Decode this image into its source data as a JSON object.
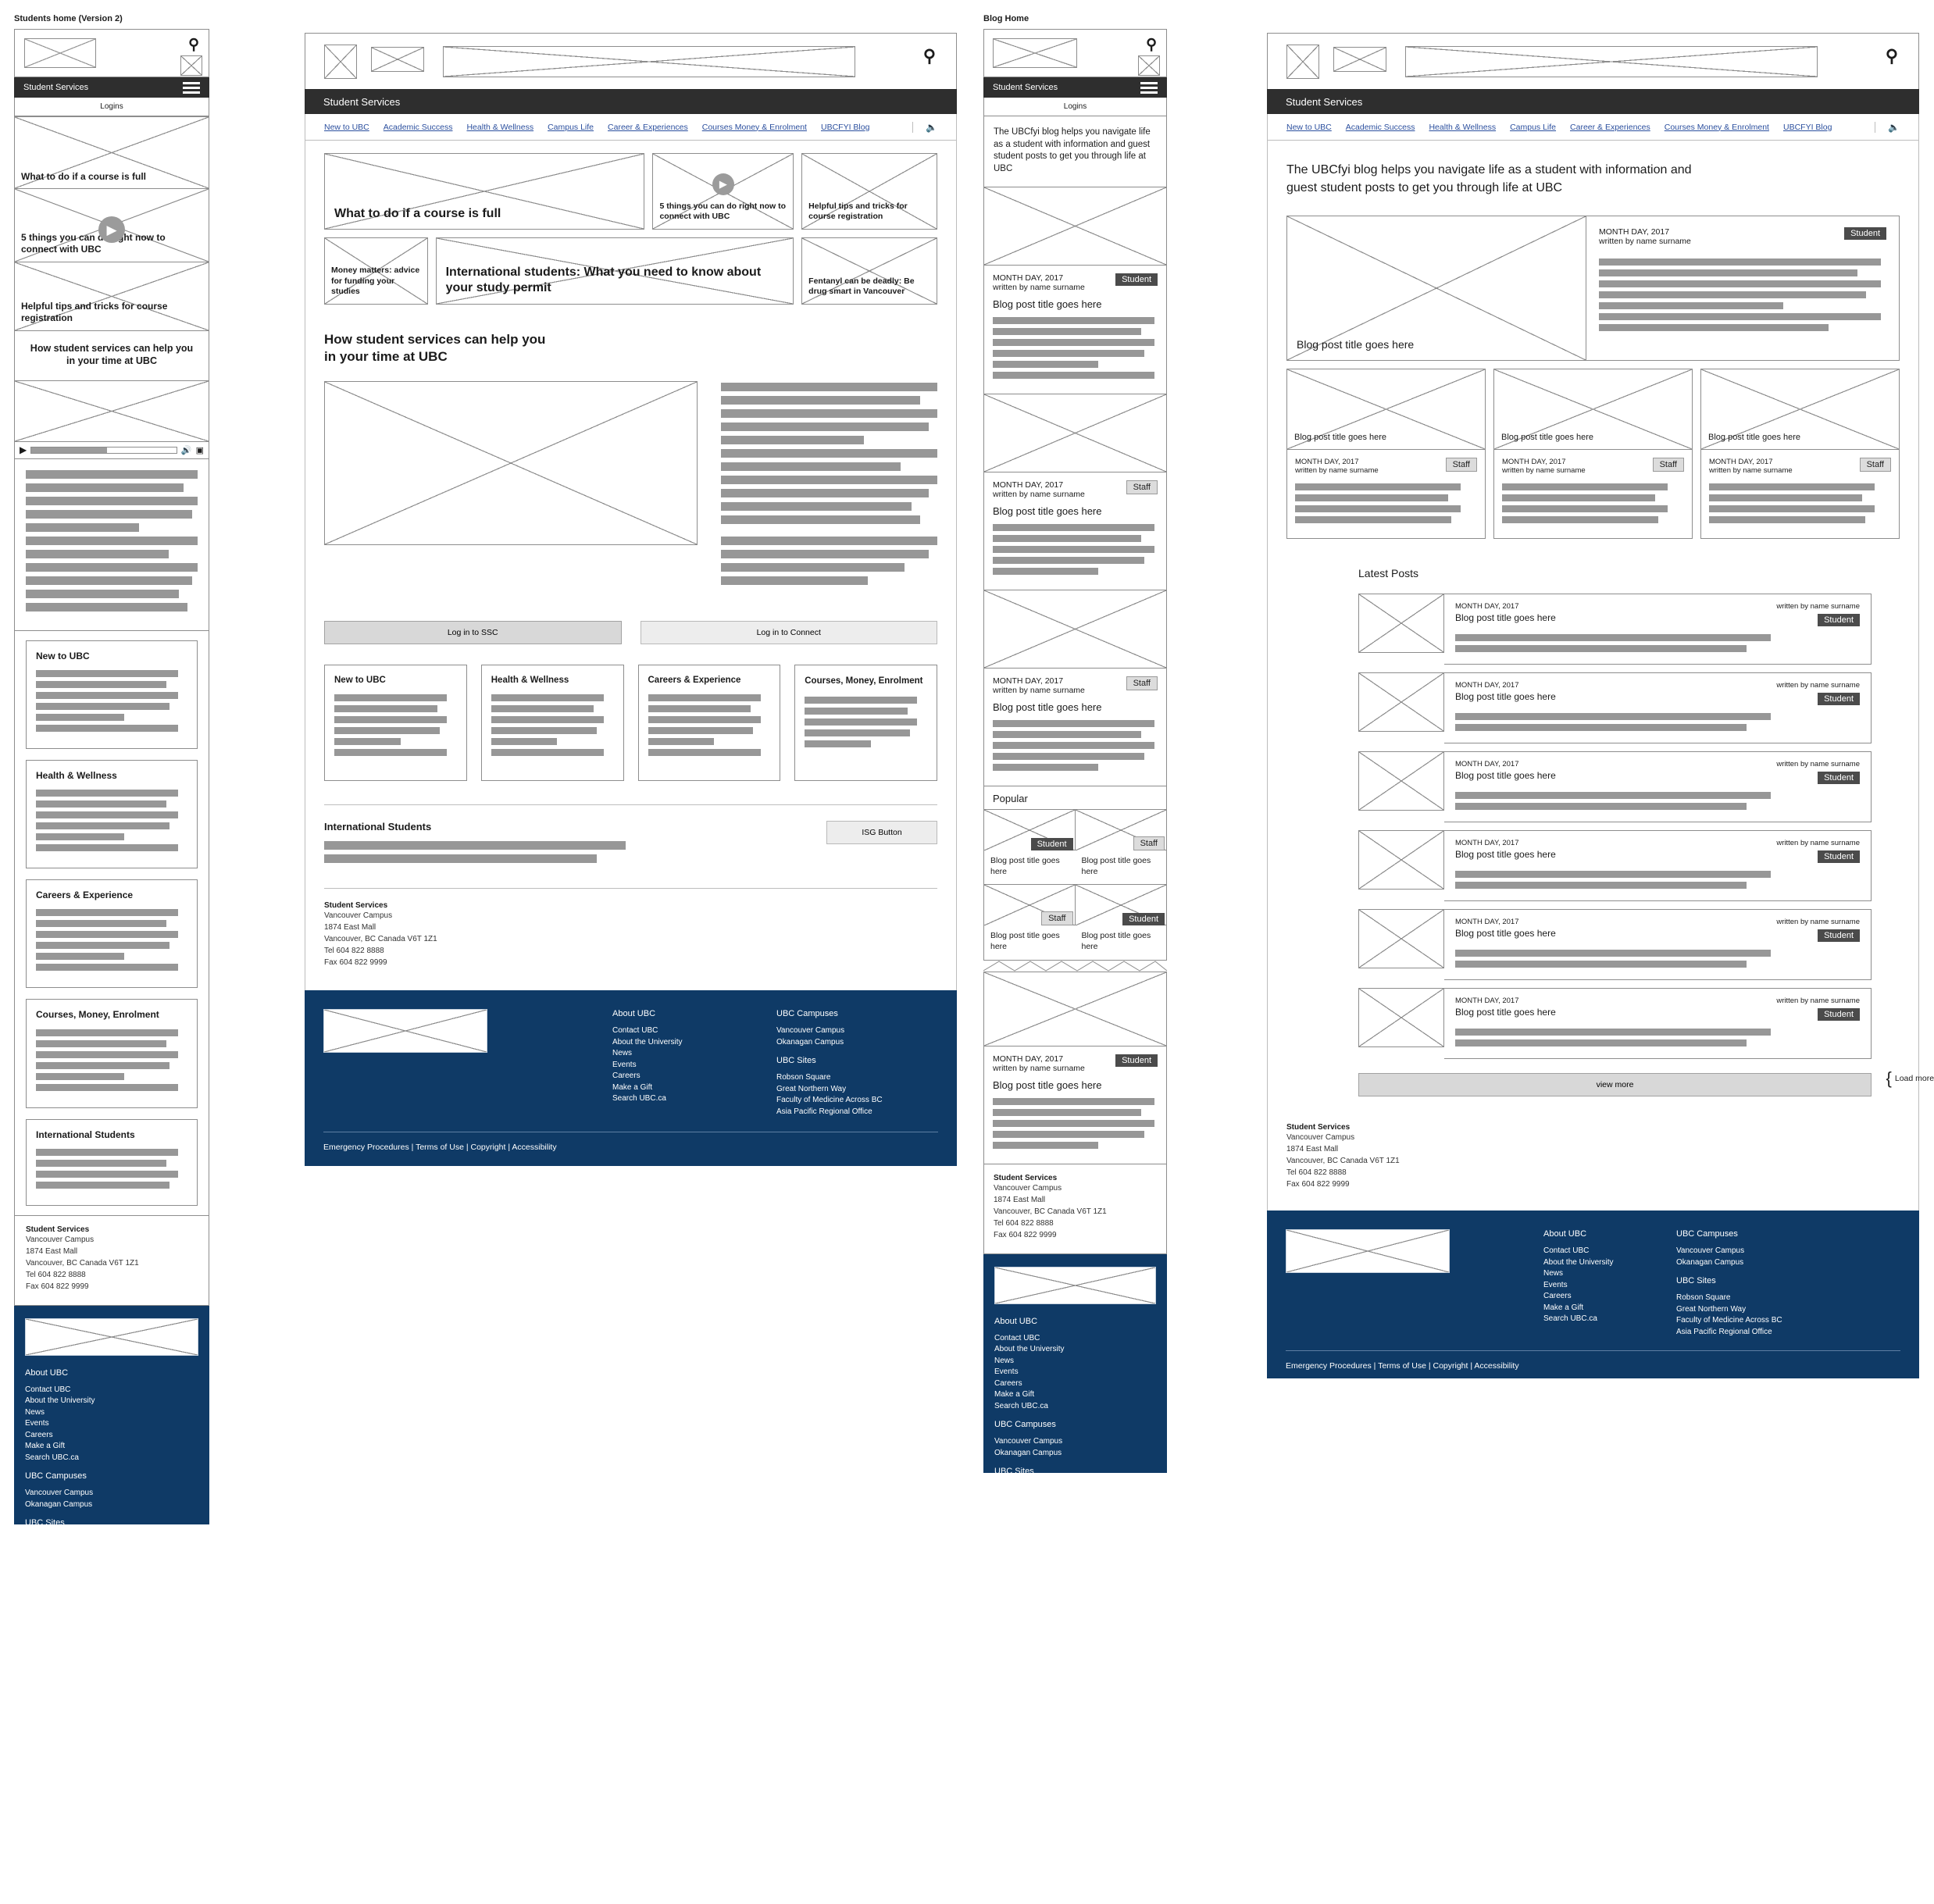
{
  "brand": {
    "site_title": "Student Services",
    "logins_label": "Logins",
    "accent_blue": "#0f3a66",
    "link_blue": "#2b4f9e",
    "bar_grey": "#979797"
  },
  "screens": [
    {
      "label": "Students home (Version 2)"
    },
    {
      "label": "Blog Home"
    }
  ],
  "nav": {
    "items": [
      "New to UBC",
      "Academic Success",
      "Health & Wellness",
      "Campus Life",
      "Career & Experiences",
      "Courses Money & Enrolment",
      "UBCFYI Blog"
    ],
    "audio_icon": "speaker-icon",
    "search_icon": "search-icon",
    "menu_icon": "hamburger-icon"
  },
  "students_home": {
    "hero_cards": [
      {
        "title": "What to do if a course is full",
        "has_video": false
      },
      {
        "title": "5 things you can do right now to connect with UBC",
        "has_video": true
      },
      {
        "title": "Helpful tips and tricks for course registration",
        "has_video": false
      },
      {
        "title": "Money matters: advice for funding your studies",
        "has_video": false
      },
      {
        "title": "International students: What you need to know about your study permit",
        "has_video": false
      },
      {
        "title": "Fentanyl can be deadly: Be drug smart in Vancouver",
        "has_video": false
      }
    ],
    "section_heading": "How student services can help you\nin your time at UBC",
    "section_heading_line1": "How student services can help you",
    "section_heading_line2": "in your time at UBC",
    "login_buttons": [
      {
        "label": "Log in to SSC"
      },
      {
        "label": "Log in to Connect"
      }
    ],
    "category_cards": [
      {
        "title": "New to UBC"
      },
      {
        "title": "Health & Wellness"
      },
      {
        "title": "Careers & Experience"
      },
      {
        "title": "Courses, Money, Enrolment"
      }
    ],
    "mobile_category_cards": [
      {
        "title": "New to UBC"
      },
      {
        "title": "Health & Wellness"
      },
      {
        "title": "Careers & Experience"
      },
      {
        "title": "Courses, Money, Enrolment"
      },
      {
        "title": "International Students"
      }
    ],
    "international": {
      "title": "International Students",
      "button_label": "ISG Button"
    },
    "video_player": {
      "play_icon": "play-icon",
      "volume_icon": "volume-icon",
      "fullscreen_icon": "fullscreen-icon"
    }
  },
  "blog_home": {
    "intro_desktop": "The UBCfyi blog helps you navigate life as a student with information and guest student posts to get you through life at UBC",
    "intro_mobile": "The UBCfyi blog helps you navigate life as a student with information and guest student posts to get you through life at UBC",
    "featured_large": {
      "title": "Blog post title goes here",
      "date": "MONTH DAY, 2017",
      "byline": "written by name surname",
      "badge": "Student"
    },
    "featured_row": [
      {
        "title": "Blog post title goes here",
        "date": "MONTH DAY, 2017",
        "byline": "written by name surname",
        "badge": "Staff"
      },
      {
        "title": "Blog post title goes here",
        "date": "MONTH DAY, 2017",
        "byline": "written by name surname",
        "badge": "Staff"
      },
      {
        "title": "Blog post title goes here",
        "date": "MONTH DAY, 2017",
        "byline": "written by name surname",
        "badge": "Staff"
      }
    ],
    "latest_posts_heading": "Latest Posts",
    "latest_posts": [
      {
        "date": "MONTH DAY, 2017",
        "title": "Blog post title goes here",
        "byline": "written by name surname",
        "badge": "Student"
      },
      {
        "date": "MONTH DAY, 2017",
        "title": "Blog post title goes here",
        "byline": "written by name surname",
        "badge": "Student"
      },
      {
        "date": "MONTH DAY, 2017",
        "title": "Blog post title goes here",
        "byline": "written by name surname",
        "badge": "Student"
      },
      {
        "date": "MONTH DAY, 2017",
        "title": "Blog post title goes here",
        "byline": "written by name surname",
        "badge": "Student"
      },
      {
        "date": "MONTH DAY, 2017",
        "title": "Blog post title goes here",
        "byline": "written by name surname",
        "badge": "Student"
      },
      {
        "date": "MONTH DAY, 2017",
        "title": "Blog post title goes here",
        "byline": "written by name surname",
        "badge": "Student"
      }
    ],
    "view_more_label": "view more",
    "load_more_annotation": "Load more on click",
    "mobile_posts": [
      {
        "date": "MONTH DAY, 2017",
        "byline": "written by name surname",
        "title": "Blog post title goes here",
        "badge": "Student"
      },
      {
        "date": "MONTH DAY, 2017",
        "byline": "written by name surname",
        "title": "Blog post title goes here",
        "badge": "Staff"
      },
      {
        "date": "MONTH DAY, 2017",
        "byline": "written by name surname",
        "title": "Blog post title goes here",
        "badge": "Staff"
      }
    ],
    "popular_heading": "Popular",
    "popular_posts": [
      {
        "title": "Blog post title goes here",
        "badge": "Student"
      },
      {
        "title": "Blog post title goes here",
        "badge": "Staff"
      },
      {
        "title": "Blog post title goes here",
        "badge": "Staff"
      },
      {
        "title": "Blog post title goes here",
        "badge": "Student"
      }
    ],
    "mobile_tail_post": {
      "date": "MONTH DAY, 2017",
      "byline": "written by name surname",
      "title": "Blog post title goes here",
      "badge": "Student"
    }
  },
  "address": {
    "title": "Student Services",
    "lines": [
      "Vancouver Campus",
      "1874 East Mall",
      "Vancouver, BC Canada V6T 1Z1",
      "Tel 604 822 8888",
      "Fax 604 822 9999"
    ]
  },
  "footer": {
    "col1_heading": "About UBC",
    "col1_links": [
      "Contact UBC",
      "About the University",
      "News",
      "Events",
      "Careers",
      "Make a Gift",
      "Search UBC.ca"
    ],
    "col2_heading": "UBC Campuses",
    "col2_links": [
      "Vancouver Campus",
      "Okanagan Campus"
    ],
    "col3_heading": "UBC Sites",
    "col3_links": [
      "Robson Square",
      "Great Northern Way",
      "Faculty of Medicine Across BC",
      "Asia Pacific Regional Office"
    ],
    "legal": "Emergency Procedures | Terms of Use | Copyright | Accessibility"
  }
}
